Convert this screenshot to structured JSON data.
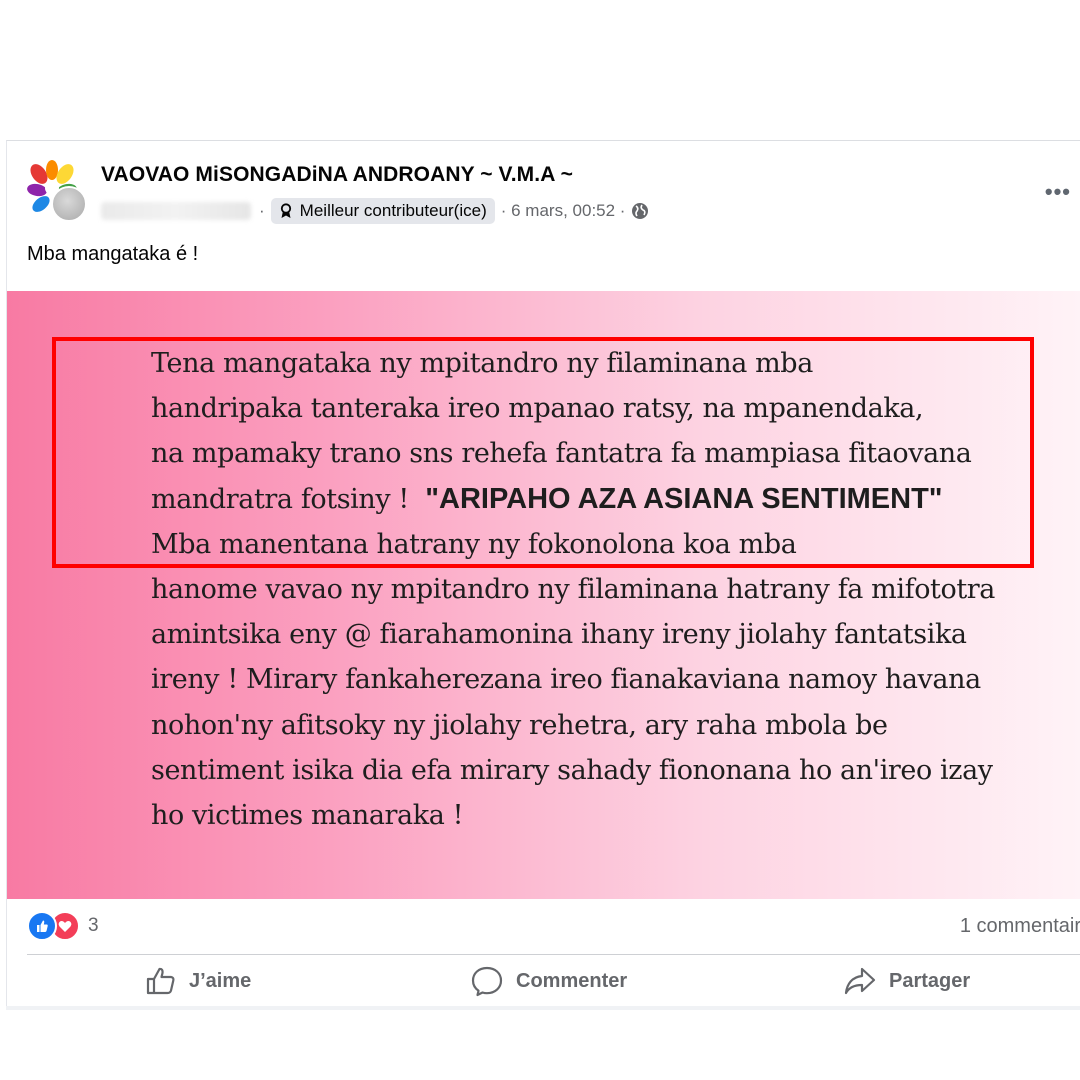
{
  "post": {
    "group_name": "VAOVAO MiSONGADiNA ANDROANY ~ V.M.A ~",
    "badge_label": "Meilleur contributeur(ice)",
    "timestamp": "· 6 mars, 00:52 ·",
    "separator": "·",
    "text": "Mba mangataka é !"
  },
  "image": {
    "lines": [
      "Tena mangataka ny mpitandro ny filaminana mba",
      "handripaka tanteraka ireo mpanao ratsy, na mpanendaka,",
      "na mpamaky trano sns rehefa fantatra fa mampiasa fitaovana",
      "mandratra fotsiny !",
      "\"ARIPAHO AZA ASIANA SENTIMENT\"",
      "Mba manentana hatrany ny fokonolona koa mba",
      "hanome vavao ny mpitandro ny filaminana hatrany fa mifototra",
      "amintsika eny @ fiarahamonina ihany ireny jiolahy fantatsika",
      "ireny ! Mirary fankaherezana ireo fianakaviana namoy havana",
      "nohon'ny afitsoky ny jiolahy rehetra, ary raha mbola be",
      "sentiment isika dia efa mirary sahady fiononana ho an'ireo izay",
      "ho victimes manaraka !"
    ],
    "highlight_color": "#ff0000"
  },
  "footer": {
    "reaction_count": "3",
    "reactions": [
      "like-icon",
      "love-icon"
    ],
    "comments_label": "1 commentair",
    "like_label": "J’aime",
    "comment_label": "Commenter",
    "share_label": "Partager"
  },
  "colors": {
    "like_blue": "#1877f2",
    "love_red": "#f33e58",
    "gradient_left": "#f87aa3",
    "gradient_right": "#fff3f7"
  }
}
